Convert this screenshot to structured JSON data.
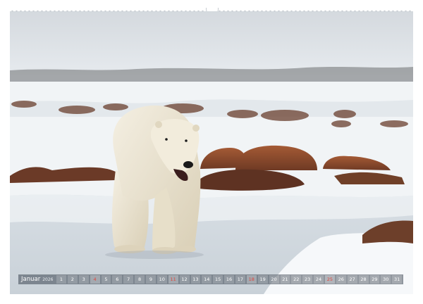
{
  "calendar": {
    "month": "Januar",
    "year": "2026",
    "days": [
      {
        "n": "1",
        "sunday": false
      },
      {
        "n": "2",
        "sunday": false
      },
      {
        "n": "3",
        "sunday": false
      },
      {
        "n": "4",
        "sunday": true
      },
      {
        "n": "5",
        "sunday": false
      },
      {
        "n": "6",
        "sunday": false
      },
      {
        "n": "7",
        "sunday": false
      },
      {
        "n": "8",
        "sunday": false
      },
      {
        "n": "9",
        "sunday": false
      },
      {
        "n": "10",
        "sunday": false
      },
      {
        "n": "11",
        "sunday": true
      },
      {
        "n": "12",
        "sunday": false
      },
      {
        "n": "13",
        "sunday": false
      },
      {
        "n": "14",
        "sunday": false
      },
      {
        "n": "15",
        "sunday": false
      },
      {
        "n": "16",
        "sunday": false
      },
      {
        "n": "17",
        "sunday": false
      },
      {
        "n": "18",
        "sunday": true
      },
      {
        "n": "19",
        "sunday": false
      },
      {
        "n": "20",
        "sunday": false
      },
      {
        "n": "21",
        "sunday": false
      },
      {
        "n": "22",
        "sunday": false
      },
      {
        "n": "23",
        "sunday": false
      },
      {
        "n": "24",
        "sunday": false
      },
      {
        "n": "25",
        "sunday": true
      },
      {
        "n": "26",
        "sunday": false
      },
      {
        "n": "27",
        "sunday": false
      },
      {
        "n": "28",
        "sunday": false
      },
      {
        "n": "29",
        "sunday": false
      },
      {
        "n": "30",
        "sunday": false
      },
      {
        "n": "31",
        "sunday": false
      }
    ]
  },
  "colors": {
    "sunday": "#e2463c",
    "strip": "#3c4652",
    "ice": "#dfe6ec",
    "rock": "#8a4a2e",
    "bear_fur": "#ece5d2"
  },
  "photo": {
    "subject": "polar-bear"
  }
}
